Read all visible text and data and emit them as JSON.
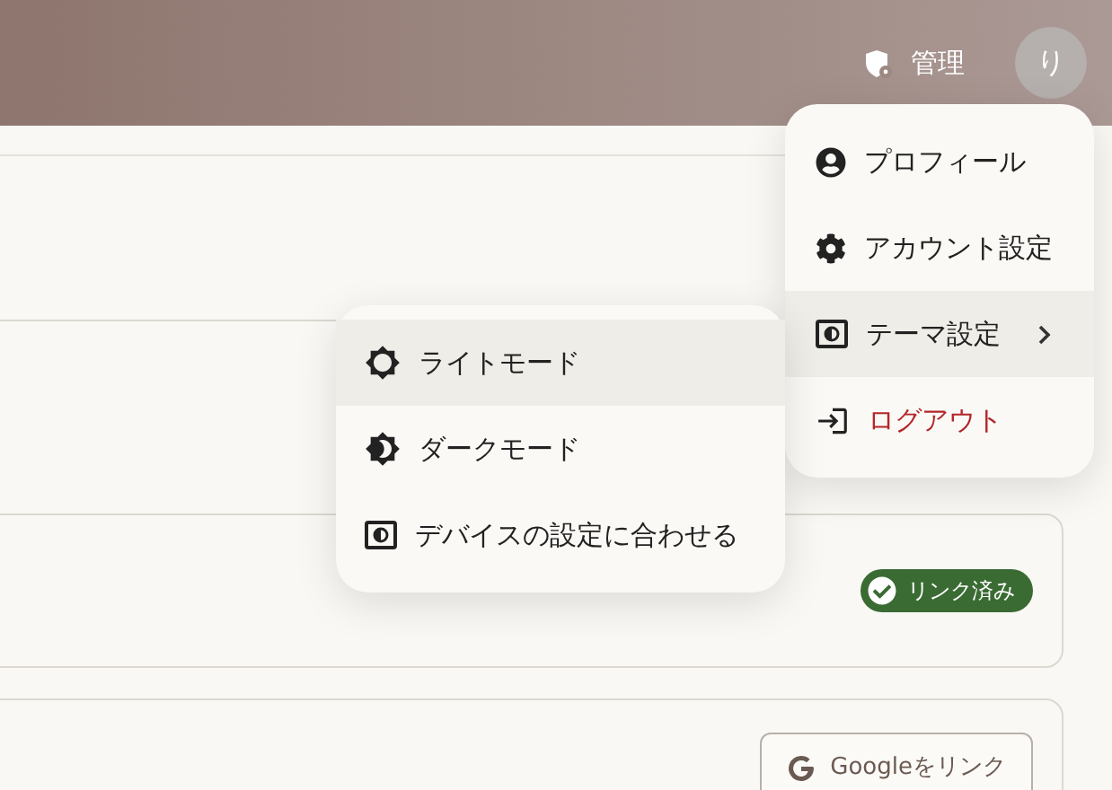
{
  "header": {
    "admin_link": "管理",
    "avatar": "り"
  },
  "user_menu": {
    "items": [
      {
        "label": "プロフィール",
        "kind": "normal",
        "highlighted": false,
        "submenu": false
      },
      {
        "label": "アカウント設定",
        "kind": "normal",
        "highlighted": false,
        "submenu": false
      },
      {
        "label": "テーマ設定",
        "kind": "normal",
        "highlighted": true,
        "submenu": true
      },
      {
        "label": "ログアウト",
        "kind": "danger",
        "highlighted": false,
        "submenu": false
      }
    ]
  },
  "theme_menu": {
    "items": [
      {
        "label": "ライトモード",
        "selected": true
      },
      {
        "label": "ダークモード",
        "selected": false
      },
      {
        "label": "デバイスの設定に合わせる",
        "selected": false
      }
    ]
  },
  "linked_account": {
    "badge": "リンク済み"
  },
  "google_account": {
    "button": "Googleをリンク"
  }
}
